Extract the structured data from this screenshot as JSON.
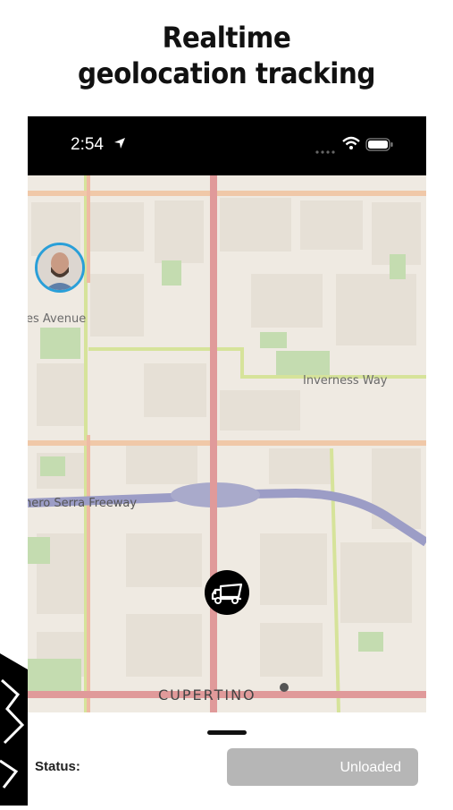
{
  "headline": {
    "line1": "Realtime",
    "line2": "geolocation tracking"
  },
  "status_bar": {
    "time": "2:54",
    "icons": [
      "location-arrow-icon",
      "signal-dots-icon",
      "wifi-icon",
      "battery-icon"
    ]
  },
  "map": {
    "labels": {
      "avenue": "es Avenue",
      "inverness": "Inverness Way",
      "freeway": "nero Serra Freeway",
      "cupertino": "CUPERTINO"
    },
    "colors": {
      "background": "#efeae2",
      "major_road": "#e09a9a",
      "secondary_road": "#f0c8a8",
      "minor_road": "#d6e39a",
      "freeway": "#9c9dc6",
      "park": "#c4dcb0",
      "avatar_ring": "#2a9fd8"
    }
  },
  "bottom_sheet": {
    "status_label": "Status:",
    "status_value": "Unloaded"
  }
}
